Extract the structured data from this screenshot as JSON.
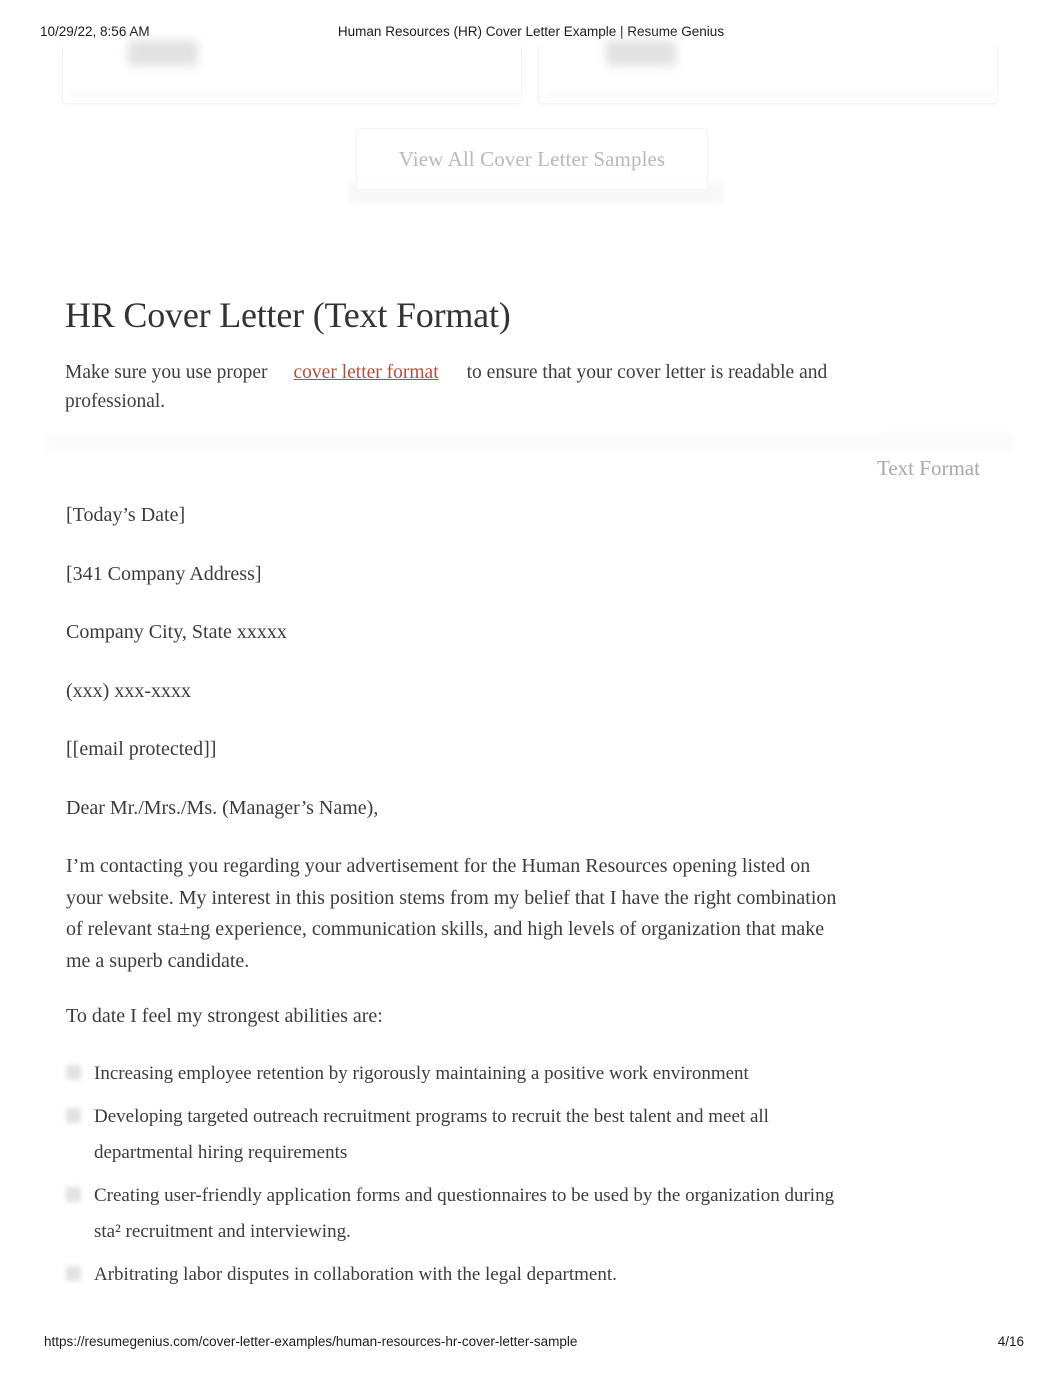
{
  "print_header": {
    "date": "10/29/22, 8:56 AM",
    "title": "Human Resources (HR) Cover Letter Example | Resume Genius"
  },
  "top_section": {
    "samples_button_label": "View All Cover Letter Samples"
  },
  "article": {
    "title": "HR Cover Letter (Text Format)",
    "intro_before": "Make sure you use proper",
    "intro_link": "cover letter format",
    "intro_after": "to ensure that your cover letter is readable and professional.",
    "tab_label": "Text Format"
  },
  "letter": {
    "lines": [
      "[Today’s Date]",
      "[341 Company Address]",
      "Company City, State xxxxx",
      "(xxx) xxx-xxxx",
      "[[email protected]]",
      "Dear Mr./Mrs./Ms. (Manager’s Name),"
    ],
    "paragraph_1": "I’m contacting you regarding your advertisement for the Human Resources opening listed on your website. My interest in this position stems from my belief that I have the right combination of relevant sta±ng experience, communication skills, and high levels of organization that make me a superb candidate.",
    "paragraph_2": "To date I feel my strongest abilities are:",
    "bullets": [
      "Increasing employee retention by rigorously maintaining a positive work environment",
      "Developing targeted outreach recruitment programs to recruit the best talent and meet all departmental hiring requirements",
      "Creating user-friendly application forms and questionnaires to be used by the organization during sta² recruitment and interviewing.",
      "Arbitrating labor disputes in collaboration with the legal department."
    ]
  },
  "print_footer": {
    "url": "https://resumegenius.com/cover-letter-examples/human-resources-hr-cover-letter-sample",
    "page": "4/16"
  },
  "colors": {
    "link": "#b0503c",
    "body_text": "#3c3c3c",
    "muted_text": "#a8a8a8",
    "heading": "#333333",
    "page_background": "#ffffff"
  }
}
